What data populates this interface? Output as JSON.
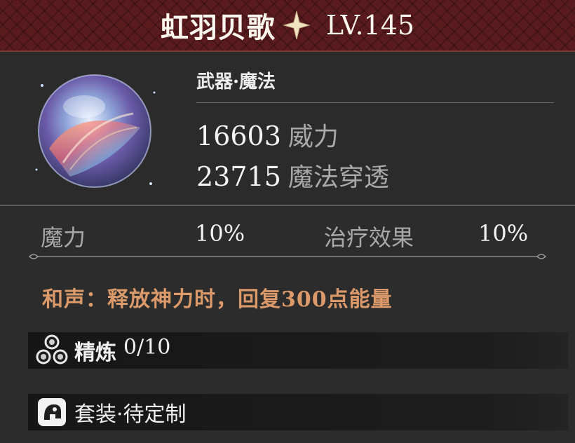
{
  "header": {
    "title": "虹羽贝歌",
    "star_icon": "sparkle-star-icon",
    "level": "LV.145"
  },
  "item": {
    "category": "武器·魔法",
    "stats": [
      {
        "value": "16603",
        "label": "威力"
      },
      {
        "value": "23715",
        "label": "魔法穿透"
      }
    ]
  },
  "attributes": [
    {
      "name": "魔力",
      "value": "10%"
    },
    {
      "name": "治疗效果",
      "value": "10%"
    }
  ],
  "effect": "和声：释放神力时，回复300点能量",
  "refine": {
    "label": "精炼",
    "value": "0/10",
    "icon": "refine-hexagons-icon"
  },
  "set": {
    "label": "套装·待定制",
    "icon": "set-helmet-icon"
  },
  "colors": {
    "header_bg": "#5a1b1e",
    "panel_bg": "#2b2b2b",
    "effect_text": "#dc9a6a",
    "secondary_text": "#a8a8a8"
  }
}
